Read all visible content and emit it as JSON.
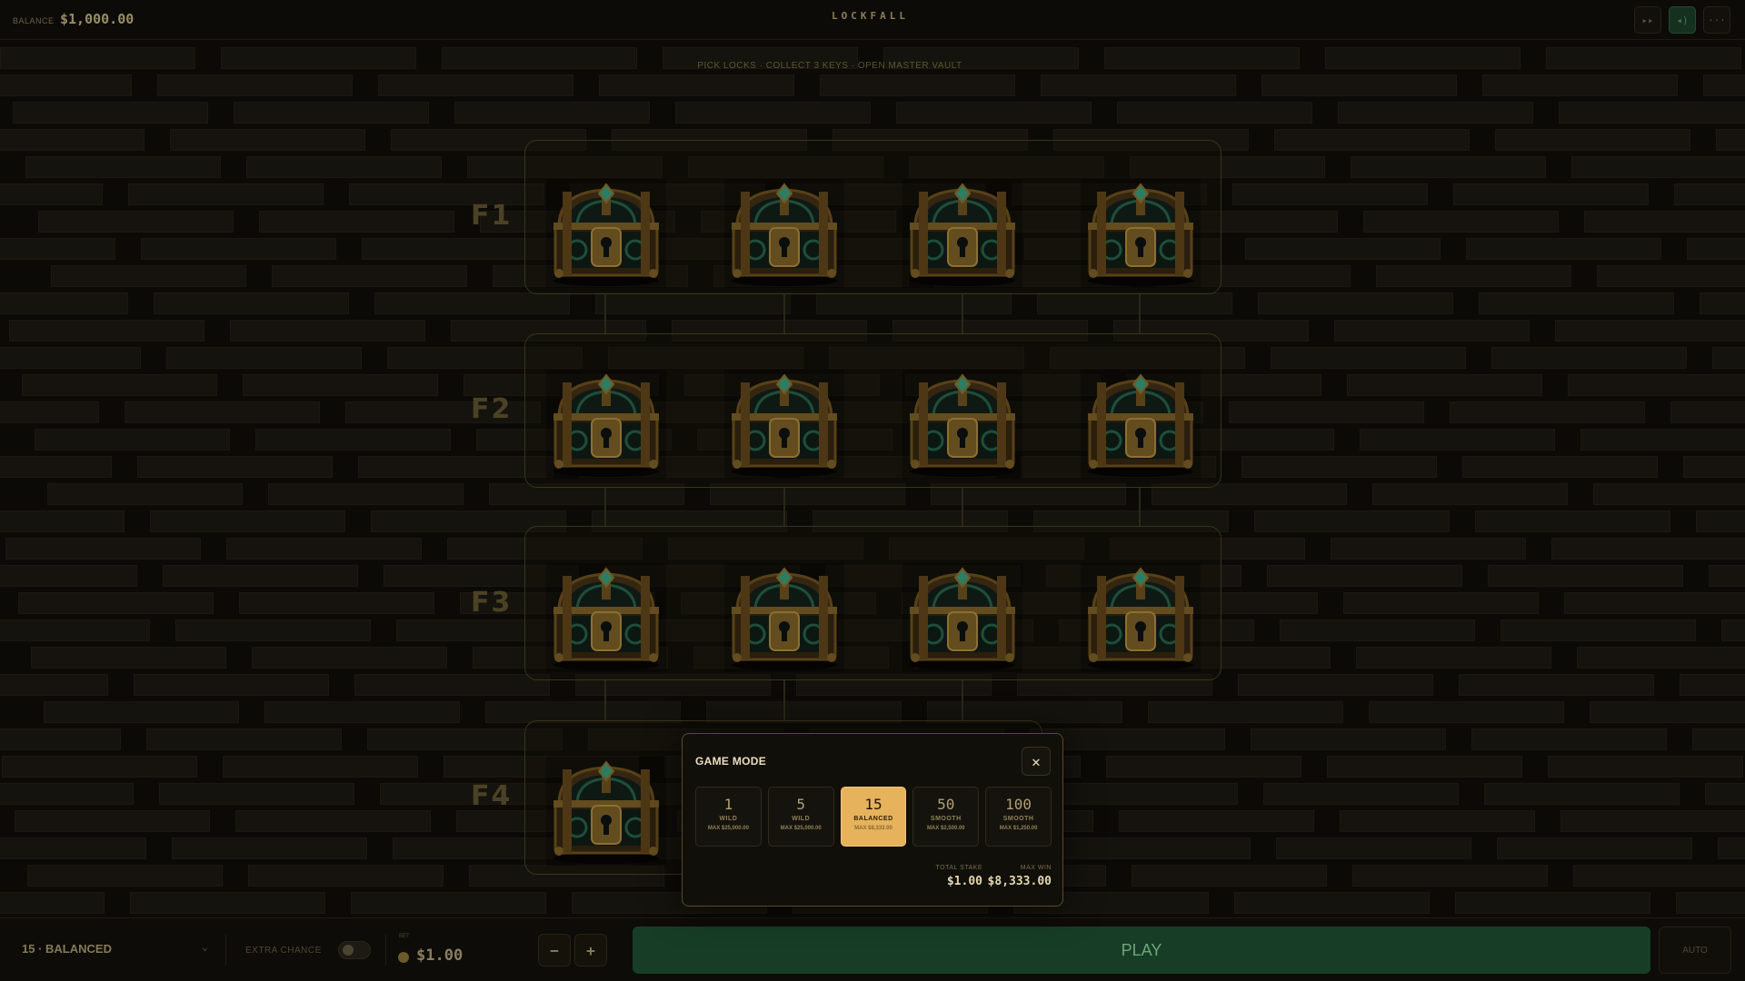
{
  "header": {
    "balance_label": "BALANCE",
    "balance_value": "$1,000.00",
    "logo": "LOCKFALL",
    "controls": [
      {
        "icon": "fast-forward-icon",
        "glyph": "▸▸"
      },
      {
        "icon": "sound-icon",
        "glyph": "◂)"
      },
      {
        "icon": "menu-icon",
        "glyph": "···"
      }
    ]
  },
  "tagline": "PICK LOCKS · COLLECT 3 KEYS · OPEN MASTER VAULT",
  "floors": [
    {
      "label": "F1",
      "chests": 4
    },
    {
      "label": "F2",
      "chests": 4
    },
    {
      "label": "F3",
      "chests": 4
    },
    {
      "label": "F4",
      "chests": 1
    }
  ],
  "modal": {
    "title": "GAME MODE",
    "close_icon": "close-icon",
    "modes": [
      {
        "value": "1",
        "name": "WILD",
        "max": "MAX $25,000.00",
        "selected": false
      },
      {
        "value": "5",
        "name": "WILD",
        "max": "MAX $25,000.00",
        "selected": false
      },
      {
        "value": "15",
        "name": "BALANCED",
        "max": "MAX $8,333.00",
        "selected": true
      },
      {
        "value": "50",
        "name": "SMOOTH",
        "max": "MAX $2,500.00",
        "selected": false
      },
      {
        "value": "100",
        "name": "SMOOTH",
        "max": "MAX $1,250.00",
        "selected": false
      }
    ],
    "total_stake_label": "TOTAL STAKE",
    "total_stake_value": "$1.00",
    "max_win_label": "MAX WIN",
    "max_win_value": "$8,333.00"
  },
  "footer": {
    "mode_select": "15 · BALANCED",
    "extra_chance_label": "EXTRA CHANCE",
    "extra_chance_on": false,
    "bet_label": "BET",
    "bet_value": "$1.00",
    "minus": "−",
    "plus": "+",
    "play": "PLAY",
    "auto": "AUTO"
  },
  "colors": {
    "accent_gold": "#e6b25b",
    "play_green": "#173d26",
    "background": "#0b0a07"
  }
}
